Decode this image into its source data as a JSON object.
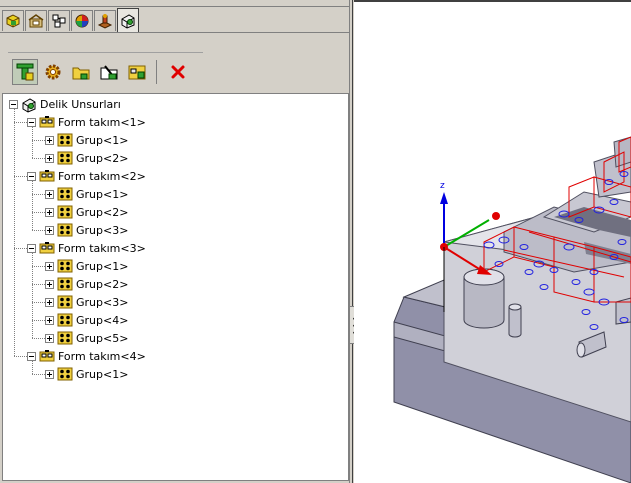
{
  "tabs": [
    {
      "icon": "part-icon",
      "active": false
    },
    {
      "icon": "property-icon",
      "active": false
    },
    {
      "icon": "configuration-icon",
      "active": false
    },
    {
      "icon": "appearance-icon",
      "active": false
    },
    {
      "icon": "cam-icon",
      "active": false
    },
    {
      "icon": "hole-feature-icon",
      "active": true
    }
  ],
  "toolbar": {
    "buttons": [
      "hole-wizard-icon",
      "settings-gear-icon",
      "folder-icon",
      "tool-folder-icon",
      "group-folder-icon"
    ],
    "delete_icon": "delete-x-icon",
    "delete_color": "#e00000"
  },
  "tree": {
    "root": "Delik Unsurları",
    "forms": [
      {
        "label": "Form takım<1>",
        "groups": [
          "Grup<1>",
          "Grup<2>"
        ]
      },
      {
        "label": "Form takım<2>",
        "groups": [
          "Grup<1>",
          "Grup<2>",
          "Grup<3>"
        ]
      },
      {
        "label": "Form takım<3>",
        "groups": [
          "Grup<1>",
          "Grup<2>",
          "Grup<3>",
          "Grup<4>",
          "Grup<5>"
        ]
      },
      {
        "label": "Form takım<4>",
        "groups": [
          "Grup<1>"
        ]
      }
    ]
  },
  "viewport": {
    "axis_z_label": "z",
    "colors": {
      "z_axis": "#0000e0",
      "x_axis": "#e00000",
      "y_axis": "#00b000",
      "highlight": "#e00000",
      "holes": "#2020e0",
      "part": "#c8c8c8"
    }
  }
}
